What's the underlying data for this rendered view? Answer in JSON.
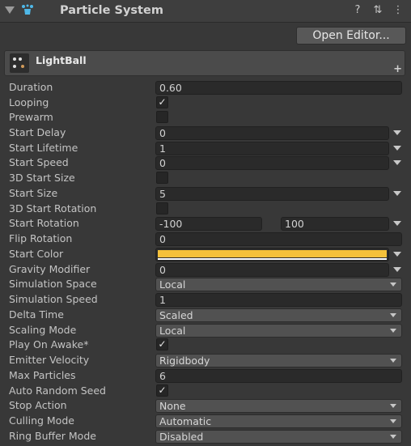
{
  "header": {
    "title": "Particle System",
    "icons": [
      "fold-arrow-icon",
      "particle-system-icon",
      "help-icon",
      "presets-icon",
      "more-menu-icon"
    ],
    "help_glyph": "?",
    "presets_glyph": "⇅",
    "menu_glyph": "⋮"
  },
  "open_editor_label": "Open Editor...",
  "module": {
    "name": "LightBall",
    "plus_glyph": "+"
  },
  "checkmark": "✓",
  "colors": {
    "start_color": "#f5c13a",
    "accent_icon": "#4fb8e8"
  },
  "fields": {
    "duration": {
      "label": "Duration",
      "value": "0.60"
    },
    "looping": {
      "label": "Looping",
      "checked": true
    },
    "prewarm": {
      "label": "Prewarm",
      "checked": false
    },
    "start_delay": {
      "label": "Start Delay",
      "value": "0"
    },
    "start_lifetime": {
      "label": "Start Lifetime",
      "value": "1"
    },
    "start_speed": {
      "label": "Start Speed",
      "value": "0"
    },
    "start_size_3d": {
      "label": "3D Start Size",
      "checked": false
    },
    "start_size": {
      "label": "Start Size",
      "value": "5"
    },
    "start_rotation_3d": {
      "label": "3D Start Rotation",
      "checked": false
    },
    "start_rotation": {
      "label": "Start Rotation",
      "min": "-100",
      "max": "100"
    },
    "flip_rotation": {
      "label": "Flip Rotation",
      "value": "0"
    },
    "start_color": {
      "label": "Start Color"
    },
    "gravity_modifier": {
      "label": "Gravity Modifier",
      "value": "0"
    },
    "simulation_space": {
      "label": "Simulation Space",
      "value": "Local"
    },
    "simulation_speed": {
      "label": "Simulation Speed",
      "value": "1"
    },
    "delta_time": {
      "label": "Delta Time",
      "value": "Scaled"
    },
    "scaling_mode": {
      "label": "Scaling Mode",
      "value": "Local"
    },
    "play_on_awake": {
      "label": "Play On Awake*",
      "checked": true
    },
    "emitter_velocity": {
      "label": "Emitter Velocity",
      "value": "Rigidbody"
    },
    "max_particles": {
      "label": "Max Particles",
      "value": "6"
    },
    "auto_random_seed": {
      "label": "Auto Random Seed",
      "checked": true
    },
    "stop_action": {
      "label": "Stop Action",
      "value": "None"
    },
    "culling_mode": {
      "label": "Culling Mode",
      "value": "Automatic"
    },
    "ring_buffer_mode": {
      "label": "Ring Buffer Mode",
      "value": "Disabled"
    }
  }
}
